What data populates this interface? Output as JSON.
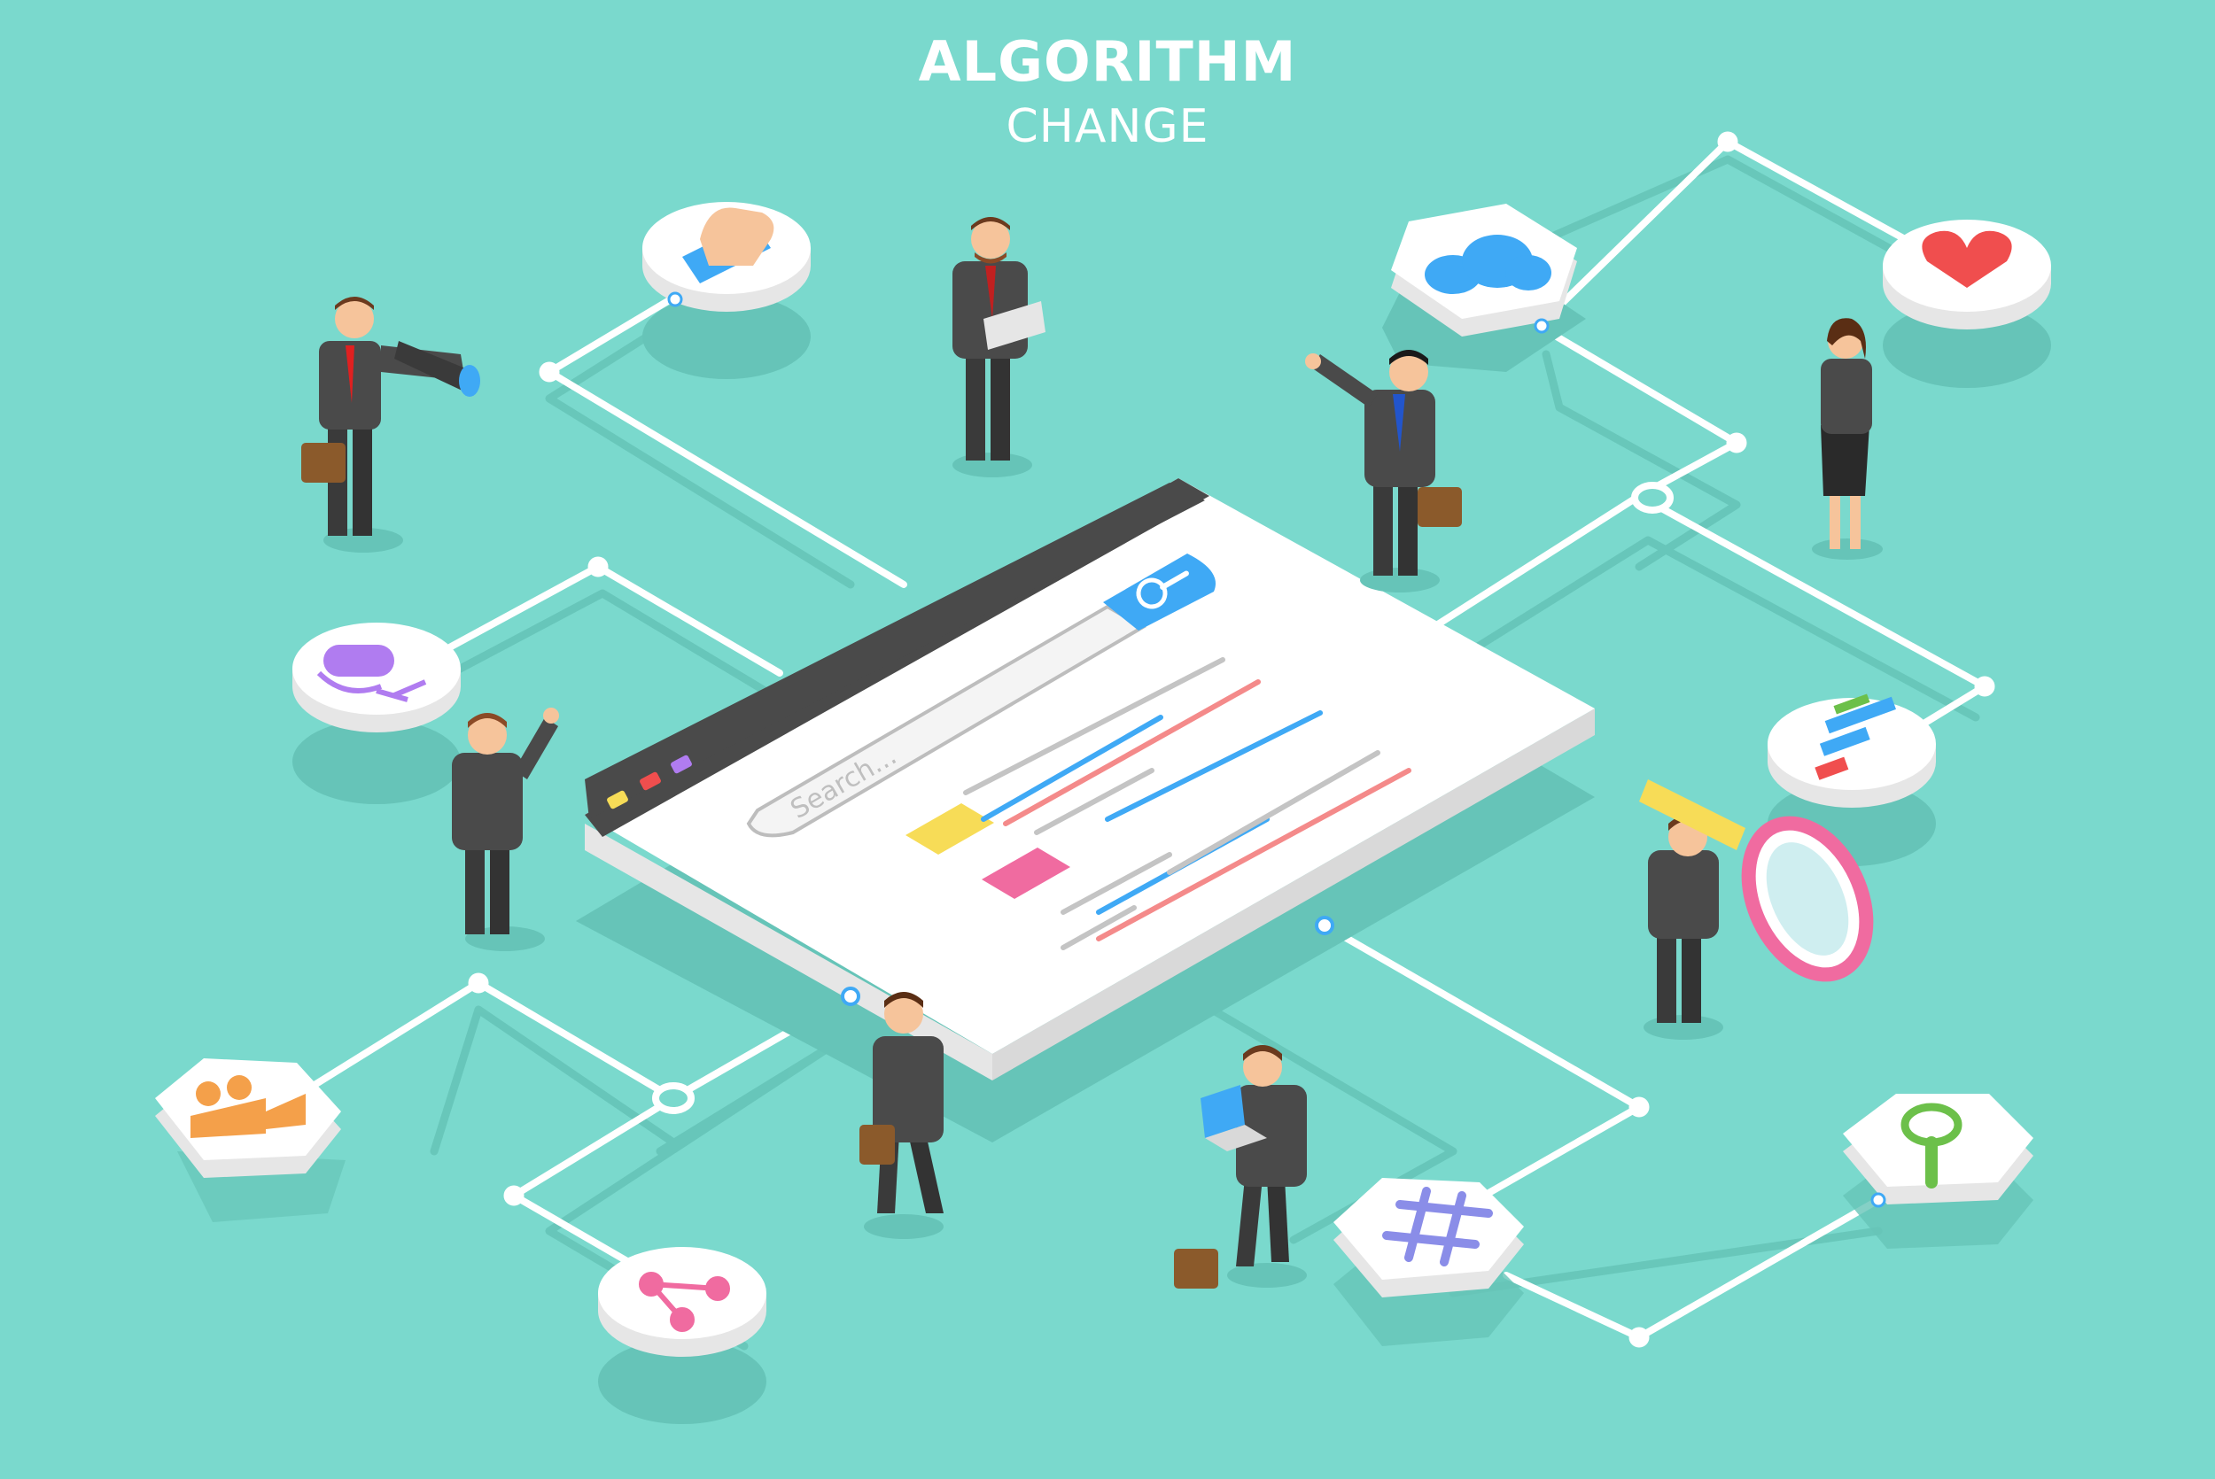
{
  "header": {
    "title": "ALGORITHM",
    "subtitle": "CHANGE"
  },
  "browser": {
    "search_placeholder": "Search..."
  },
  "colors": {
    "background": "#7ad9cd",
    "connector": "#ffffff",
    "suit": "#4a4a4a",
    "accent_blue": "#3fa9f5",
    "accent_red": "#f04e4e",
    "accent_pink": "#f06ba0",
    "accent_yellow": "#f7dc57"
  },
  "nodes": [
    {
      "id": "like",
      "icon": "thumbs-up-icon",
      "shape": "circle"
    },
    {
      "id": "cloud",
      "icon": "cloud-icon",
      "shape": "hexagon"
    },
    {
      "id": "heart",
      "icon": "heart-icon",
      "shape": "circle"
    },
    {
      "id": "mic",
      "icon": "microphone-icon",
      "shape": "circle"
    },
    {
      "id": "stats",
      "icon": "bar-chart-icon",
      "shape": "circle"
    },
    {
      "id": "video",
      "icon": "video-camera-icon",
      "shape": "hexagon"
    },
    {
      "id": "share",
      "icon": "share-icon",
      "shape": "circle"
    },
    {
      "id": "hashtag",
      "icon": "hashtag-icon",
      "shape": "hexagon"
    },
    {
      "id": "search",
      "icon": "magnifier-icon",
      "shape": "hexagon"
    }
  ]
}
